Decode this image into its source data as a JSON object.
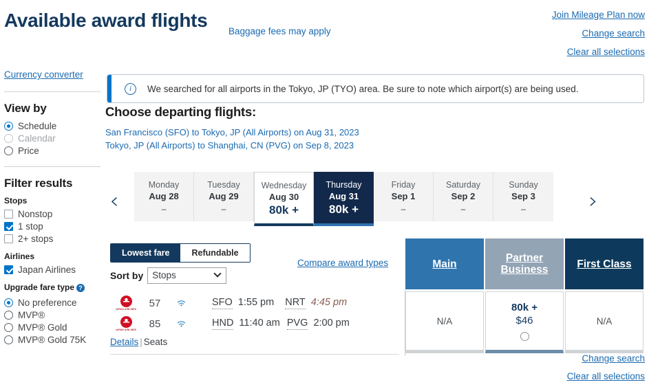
{
  "header": {
    "title": "Available award flights",
    "baggage_note": "Baggage fees may apply",
    "links": [
      {
        "label": "Join Mileage Plan now",
        "name": "join-mileage-plan-link"
      },
      {
        "label": "Change search",
        "name": "change-search-link"
      },
      {
        "label": "Clear all selections",
        "name": "clear-all-selections-link"
      }
    ]
  },
  "sidebar": {
    "currency_converter": "Currency converter",
    "view_by": {
      "heading": "View by",
      "options": [
        {
          "label": "Schedule",
          "selected": true,
          "disabled": false
        },
        {
          "label": "Calendar",
          "selected": false,
          "disabled": true
        },
        {
          "label": "Price",
          "selected": false,
          "disabled": false
        }
      ]
    },
    "filter": {
      "heading": "Filter results",
      "stops_label": "Stops",
      "stops": [
        {
          "label": "Nonstop",
          "checked": false
        },
        {
          "label": "1 stop",
          "checked": true
        },
        {
          "label": "2+ stops",
          "checked": false
        }
      ],
      "airlines_label": "Airlines",
      "airlines": [
        {
          "label": "Japan Airlines",
          "checked": true
        }
      ],
      "upgrade_label": "Upgrade fare type",
      "upgrade_help": "?",
      "upgrade": [
        {
          "label": "No preference",
          "selected": true
        },
        {
          "label": "MVP®",
          "selected": false
        },
        {
          "label": "MVP® Gold",
          "selected": false
        },
        {
          "label": "MVP® Gold 75K",
          "selected": false
        }
      ]
    }
  },
  "banner": {
    "icon": "info-icon",
    "text": "We searched for all airports in the Tokyo, JP (TYO) area. Be sure to note which airport(s) are being used."
  },
  "main": {
    "choose_heading": "Choose departing flights:",
    "routes": [
      "San Francisco (SFO) to Tokyo, JP (All Airports) on Aug 31, 2023",
      "Tokyo, JP (All Airports) to Shanghai, CN (PVG) on Sep 8, 2023"
    ],
    "prev_arrow": "‹",
    "next_arrow": "›",
    "days": [
      {
        "dow": "Monday",
        "date": "Aug 28",
        "price": "–",
        "state": "none"
      },
      {
        "dow": "Tuesday",
        "date": "Aug 29",
        "price": "–",
        "state": "none"
      },
      {
        "dow": "Wednesday",
        "date": "Aug 30",
        "price": "80k +",
        "state": "available"
      },
      {
        "dow": "Thursday",
        "date": "Aug 31",
        "price": "80k +",
        "state": "selected"
      },
      {
        "dow": "Friday",
        "date": "Sep 1",
        "price": "–",
        "state": "none"
      },
      {
        "dow": "Saturday",
        "date": "Sep 2",
        "price": "–",
        "state": "none"
      },
      {
        "dow": "Sunday",
        "date": "Sep 3",
        "price": "–",
        "state": "none"
      }
    ],
    "fare_tabs": [
      {
        "label": "Lowest fare",
        "active": true
      },
      {
        "label": "Refundable",
        "active": false
      }
    ],
    "sort_label": "Sort by",
    "sort_value": "Stops",
    "compare_link": "Compare award types",
    "class_columns": [
      {
        "label": "Main",
        "style": "cc-main"
      },
      {
        "label": "Partner Business",
        "style": "cc-partner"
      },
      {
        "label": "First Class",
        "style": "cc-first"
      }
    ],
    "flight": {
      "airline_logo": "japan-airlines-logo",
      "airline_word": "JAPAN AIRLINES",
      "segments": [
        {
          "flight_no": "57",
          "wifi": "wifi-icon",
          "from": "SFO",
          "dep": "1:55 pm",
          "to": "NRT",
          "arr": "4:45 pm",
          "arr_next_day": true
        },
        {
          "flight_no": "85",
          "wifi": "wifi-icon",
          "from": "HND",
          "dep": "11:40 am",
          "to": "PVG",
          "arr": "2:00 pm",
          "arr_next_day": false
        }
      ],
      "details_link": "Details",
      "separator": "|",
      "seats_label": "Seats",
      "fares": [
        {
          "value": "N/A",
          "cash": "",
          "selectable": false,
          "selected": false
        },
        {
          "value": "80k +",
          "cash": "$46",
          "selectable": true,
          "selected": true
        },
        {
          "value": "N/A",
          "cash": "",
          "selectable": false,
          "selected": false
        }
      ]
    }
  },
  "footer": {
    "links": [
      {
        "label": "Change search",
        "name": "change-search-link-bottom"
      },
      {
        "label": "Clear all selections",
        "name": "clear-all-selections-link-bottom"
      }
    ]
  },
  "colors": {
    "navy": "#14395e",
    "selected_day": "#13294b",
    "link_blue": "#1a6ab1",
    "main_class": "#2f74ad",
    "partner_class": "#93a4b5",
    "first_class": "#0d3a5c",
    "accent": "#0074c8"
  }
}
